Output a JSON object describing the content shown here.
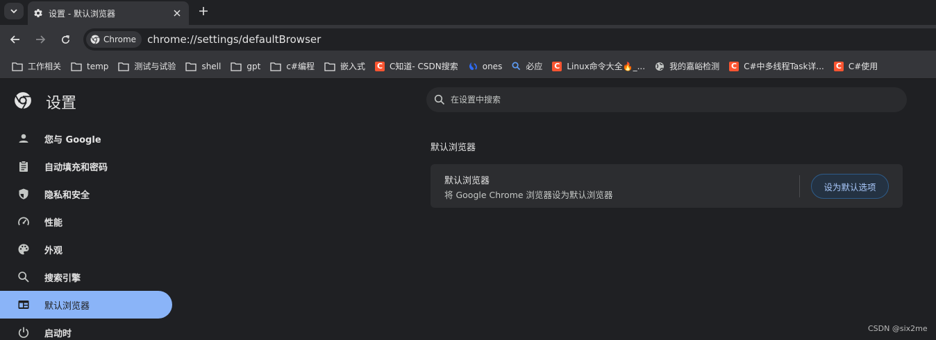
{
  "tab": {
    "title": "设置 - 默认浏览器"
  },
  "omnibox": {
    "chip": "Chrome",
    "url": "chrome://settings/defaultBrowser"
  },
  "bookmarks": [
    {
      "label": "工作相关",
      "icon": "folder-icon"
    },
    {
      "label": "temp",
      "icon": "folder-icon"
    },
    {
      "label": "测试与试验",
      "icon": "folder-icon"
    },
    {
      "label": "shell",
      "icon": "folder-icon"
    },
    {
      "label": "gpt",
      "icon": "folder-icon"
    },
    {
      "label": "c#编程",
      "icon": "folder-icon"
    },
    {
      "label": "嵌入式",
      "icon": "folder-icon"
    },
    {
      "label": "C知道- CSDN搜索",
      "icon": "csdn-icon"
    },
    {
      "label": "ones",
      "icon": "ones-icon"
    },
    {
      "label": "必应",
      "icon": "bing-search-icon"
    },
    {
      "label": "Linux命令大全🔥_...",
      "icon": "csdn-icon"
    },
    {
      "label": "我的嘉峪检测",
      "icon": "globe-icon"
    },
    {
      "label": "C#中多线程Task详...",
      "icon": "csdn-icon"
    },
    {
      "label": "C#使用",
      "icon": "csdn-icon"
    }
  ],
  "settings": {
    "title": "设置",
    "search_placeholder": "在设置中搜索",
    "nav": [
      {
        "label": "您与 Google",
        "icon": "person-icon"
      },
      {
        "label": "自动填充和密码",
        "icon": "clipboard-icon"
      },
      {
        "label": "隐私和安全",
        "icon": "shield-icon"
      },
      {
        "label": "性能",
        "icon": "speedometer-icon"
      },
      {
        "label": "外观",
        "icon": "palette-icon"
      },
      {
        "label": "搜索引擎",
        "icon": "search-icon"
      },
      {
        "label": "默认浏览器",
        "icon": "browser-window-icon",
        "active": true
      },
      {
        "label": "启动时",
        "icon": "power-icon"
      }
    ]
  },
  "main": {
    "section_title": "默认浏览器",
    "card_title": "默认浏览器",
    "card_subtitle": "将 Google Chrome 浏览器设为默认浏览器",
    "button": "设为默认选项"
  },
  "watermark": "CSDN @six2me",
  "colors": {
    "accent": "#8ab4f8",
    "csdn": "#fc5531",
    "background": "#1f2023"
  }
}
